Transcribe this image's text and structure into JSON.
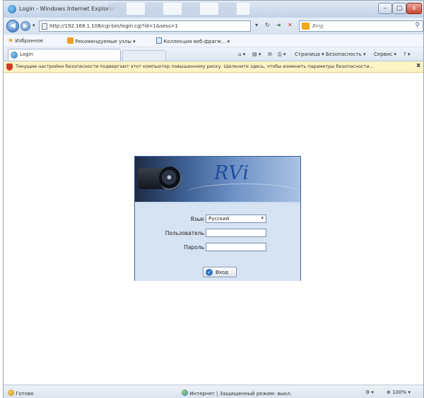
{
  "window": {
    "title": "Login - Windows Internet Explorer",
    "controls": {
      "minimize": "–",
      "maximize": "□",
      "close": "x"
    }
  },
  "address_bar": {
    "url": "http://192.168.1.108/cgi-bin/login.cgi?id=1&sess=1",
    "refresh": "↻",
    "go": "➜",
    "stop": "✕"
  },
  "search": {
    "placeholder": "Bing",
    "icon": "magnifier"
  },
  "favorites_bar": {
    "favorites": "Избранное",
    "suggested": "Рекомендуемые узлы ▾",
    "webslice": "Коллекция веб-фрагм... ▾"
  },
  "tab": {
    "label": "Login"
  },
  "command_bar": {
    "home": "⌂ ▾",
    "feeds": "▤ ▾",
    "mail": "✉",
    "print": "⎙ ▾",
    "page": "Страница ▾",
    "safety": "Безопасность ▾",
    "tools": "Сервис ▾",
    "help": "? ▾"
  },
  "info_bar": {
    "message": "Текущие настройки безопасности подвергают этот компьютер повышенному риску. Щелкните здесь, чтобы изменить параметры безопасности...",
    "close": "x"
  },
  "login": {
    "logo": "RVi",
    "language_label": "Язык",
    "language_value": "Русский",
    "user_label": "Пользователь",
    "user_value": "",
    "password_label": "Пароль",
    "password_value": "",
    "enter_label": "Вход"
  },
  "status_bar": {
    "status": "Готово",
    "zone": "Интернет | Защищенный режим: выкл.",
    "zoom": "100%",
    "zoom_arrow": "▾"
  }
}
